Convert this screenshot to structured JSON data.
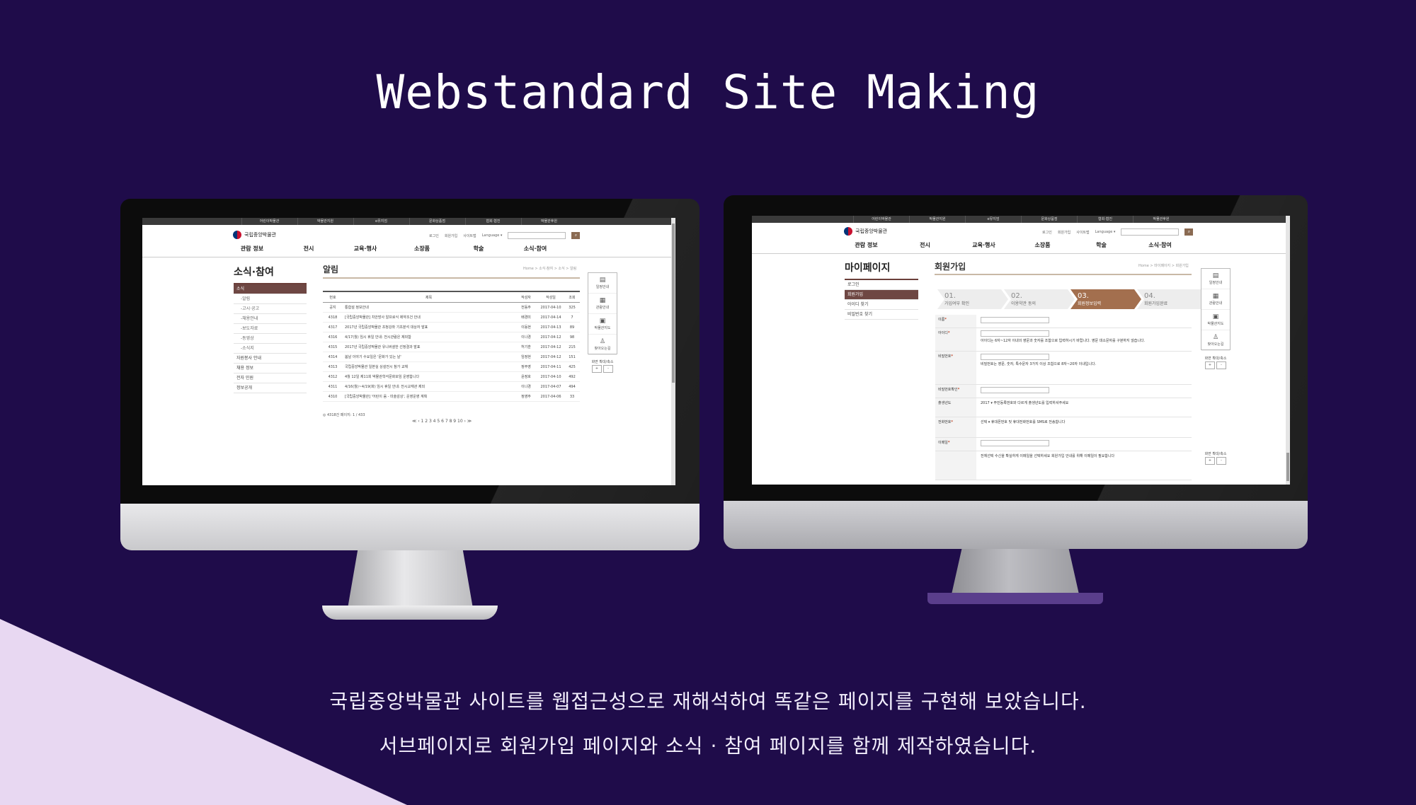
{
  "header": {
    "title": "Webstandard Site Making"
  },
  "captions": [
    "국립중앙박물관 사이트를 웹접근성으로 재해석하여 똑같은 페이지를 구현해 보았습니다.",
    "서브페이지로 회원가입 페이지와 소식 · 참여 페이지를 함께 제작하였습니다."
  ],
  "colors": {
    "background": "#1f0c4a",
    "corner": "#e8d8f2",
    "accent_brown": "#6e4743",
    "step_active": "#a36f4e"
  },
  "site": {
    "top_links": [
      "어린이박물관",
      "박물관지원",
      "e뮤지엄",
      "문화상품점",
      "협회·협진",
      "박물관후원"
    ],
    "logo_text": "국립중앙박물관",
    "util_links": [
      "로그인",
      "회원가입",
      "사이트맵"
    ],
    "language": "Language ▾",
    "search_icon": "search-icon",
    "gnb": [
      "관람 정보",
      "전시",
      "교육·행사",
      "소장품",
      "학술",
      "소식·참여"
    ],
    "quick_menu": [
      "일정안내",
      "관람안내",
      "박물관지도",
      "찾아오는길"
    ],
    "zoom_label": "화면 확대/축소",
    "zoom_plus": "+",
    "zoom_minus": "-"
  },
  "left_screen": {
    "lnb_title": "소식·참여",
    "lnb_items": [
      "소식",
      "-알림",
      "-고시·공고",
      "-채용안내",
      "-보도자료",
      "-동영상",
      "-소식지",
      "자원봉사 안내",
      "채용 정보",
      "전자 민원",
      "정보공개"
    ],
    "content_title": "알림",
    "breadcrumb": "Home > 소식·참여 > 소식 > 알림",
    "table_headers": [
      "번호",
      "제목",
      "작성자",
      "작성일",
      "조회"
    ],
    "rows": [
      [
        "공지",
        "통합설 정보안내",
        "전동주",
        "2017-04-10",
        "325"
      ],
      [
        "4318",
        "[국립중앙박물관] 치안방사 알프로식 제약조건 안내",
        "배경미",
        "2017-04-14",
        "7"
      ],
      [
        "4317",
        "2017년 국립중앙박물관 초청강좌 기초분석 대상자 발표",
        "이동현",
        "2017-04-13",
        "89"
      ],
      [
        "4316",
        "4/17(월) 임시 휴일 안내: 전시관람은 제외함",
        "이나경",
        "2017-04-12",
        "98"
      ],
      [
        "4315",
        "2017년 국립중앙박물관 유니버셜한 선정결과 발표",
        "허기훈",
        "2017-04-12",
        "215"
      ],
      [
        "4314",
        "봄날 이야기 수요일은 '문화가 있는 날'",
        "임정현",
        "2017-04-12",
        "151"
      ],
      [
        "4313",
        "국립중앙박물관 일본실 상설전시 참가 교체",
        "정주영",
        "2017-04-11",
        "425"
      ],
      [
        "4312",
        "4월 12일 제11회 박물관학석문화모임 운영합니다",
        "윤정호",
        "2017-04-10",
        "492"
      ],
      [
        "4311",
        "4/16(월)~4/19(화) 임시 휴일 안내: 전시교재관 제외",
        "이나경",
        "2017-04-07",
        "494"
      ],
      [
        "4310",
        "[국립중앙박물관] '어린이 음 - 미술감상', 운영운영 계획",
        "정영주",
        "2017-04-06",
        "33"
      ]
    ],
    "total": "◎ 4318건 페이지: 1 / 433",
    "pager": "≪ ‹ 1 2 3 4 5 6 7 8 9 10 › ≫"
  },
  "right_screen": {
    "lnb_title": "마이페이지",
    "lnb_items": [
      "로그인",
      "회원가입",
      "아이디 찾기",
      "비밀번호 찾기"
    ],
    "content_title": "회원가입",
    "breadcrumb": "Home > 마이페이지 > 회원가입",
    "steps": [
      {
        "num": "01.",
        "label": "가입여부 확인"
      },
      {
        "num": "02.",
        "label": "이용약관 동의"
      },
      {
        "num": "03.",
        "label": "회원정보입력"
      },
      {
        "num": "04.",
        "label": "회원가입완료"
      }
    ],
    "form": [
      {
        "label": "이름",
        "help": ""
      },
      {
        "label": "아이디",
        "help": "아이디는 6자~12자 이내의 영문과 숫자를 조합으로 입력하시기 바랍니다. 영문 대소문자를 구분하지 않습니다."
      },
      {
        "label": "비밀번호",
        "help": "비밀번호는 영문, 숫자, 특수문자 3가지 이상 조합으로 8자~20자 이내입니다."
      },
      {
        "label": "비밀번호확인",
        "help": ""
      },
      {
        "label": "출생년도",
        "help": "2017 ▾  주민등록번호와 다르게 출생년도를 입력하셔주세요"
      },
      {
        "label": "전화번호",
        "help": "선택 ▾  휴대폰번호 및 휴대전화번호를 SMS로 전송합니다"
      },
      {
        "label": "이메일",
        "help": ""
      },
      {
        "label": "",
        "help": "전체선택  수신을 확실하게 이메일을 선택하세요  회원가입 안내를 위해 이메일이 필요합니다"
      }
    ]
  }
}
